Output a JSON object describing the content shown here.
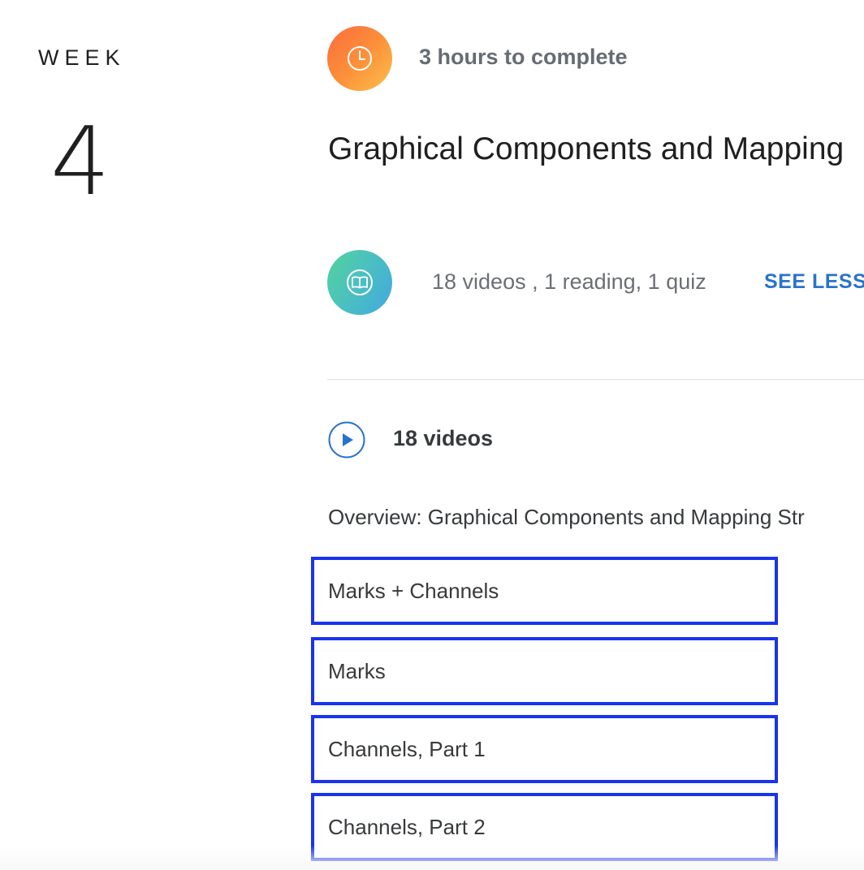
{
  "week": {
    "label": "WEEK",
    "number": "4"
  },
  "module": {
    "duration": "3 hours to complete",
    "title": "Graphical Components and Mapping",
    "summary": "18 videos , 1 reading, 1 quiz",
    "toggle_label": "SEE LESS"
  },
  "videos": {
    "heading": "18 videos",
    "overview": "Overview: Graphical Components and Mapping Str",
    "items": [
      {
        "label": "Marks + Channels"
      },
      {
        "label": "Marks"
      },
      {
        "label": "Channels, Part 1"
      },
      {
        "label": "Channels, Part 2"
      }
    ]
  },
  "icons": {
    "duration_icon": "clock-icon",
    "summary_icon": "book-icon",
    "videos_icon": "play-icon"
  },
  "colors": {
    "link": "#2a73cc",
    "highlight_border": "#1a33ee",
    "clock_gradient": [
      "#fb6b3c",
      "#fdc04a"
    ],
    "book_gradient": [
      "#53d39b",
      "#42a8e0"
    ]
  }
}
